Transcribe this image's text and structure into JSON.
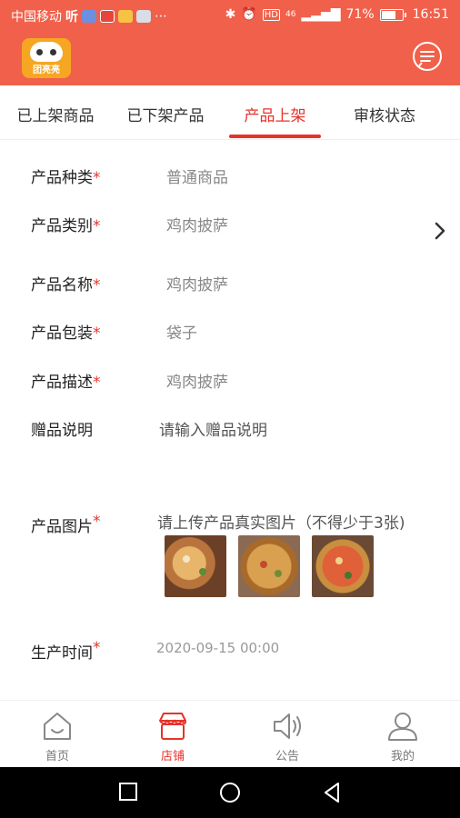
{
  "status_bar": {
    "carrier": "中国移动",
    "carrier_suffix": "听",
    "signal_label": "46",
    "battery": "71%",
    "battery_level": 0.71,
    "time": "16:51",
    "icons": [
      "shield-icon",
      "app-icon",
      "video-icon",
      "chat-icon",
      "more-icon",
      "bluetooth-icon",
      "alarm-icon",
      "hd-icon",
      "signal-icon",
      "battery-icon"
    ]
  },
  "header": {
    "logo_text": "团亮亮",
    "brand_color": "#f1604a",
    "message_icon": "message-icon"
  },
  "tabs": [
    {
      "label": "已上架商品",
      "active": false
    },
    {
      "label": "已下架产品",
      "active": false
    },
    {
      "label": "产品上架",
      "active": true
    },
    {
      "label": "审核状态",
      "active": false
    }
  ],
  "form": {
    "required_mark": "*",
    "category": {
      "label": "产品种类",
      "value": "普通商品"
    },
    "type": {
      "label": "产品类别",
      "value": "鸡肉披萨"
    },
    "name": {
      "label": "产品名称",
      "value": "鸡肉披萨"
    },
    "packaging": {
      "label": "产品包装",
      "value": "袋子"
    },
    "description": {
      "label": "产品描述",
      "value": "鸡肉披萨"
    },
    "gift": {
      "label": "赠品说明",
      "placeholder": "请输入赠品说明"
    },
    "images": {
      "label": "产品图片",
      "hint": "请上传产品真实图片（不得少于3张)"
    },
    "production_time": {
      "label": "生产时间",
      "value": "2020-09-15 00:00"
    }
  },
  "bottom_nav": [
    {
      "label": "首页",
      "icon": "home-icon",
      "active": false
    },
    {
      "label": "店铺",
      "icon": "store-icon",
      "active": true
    },
    {
      "label": "公告",
      "icon": "speaker-icon",
      "active": false
    },
    {
      "label": "我的",
      "icon": "user-icon",
      "active": false
    }
  ],
  "accent_color": "#e5332a"
}
